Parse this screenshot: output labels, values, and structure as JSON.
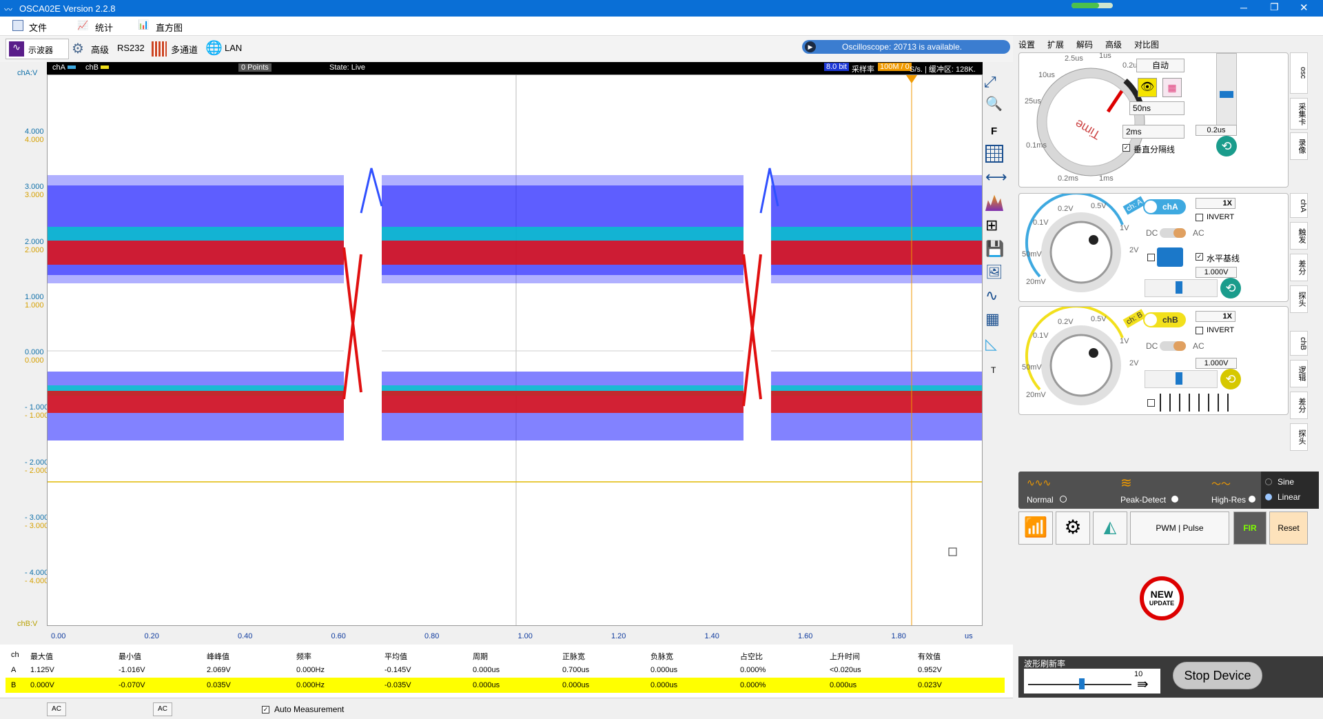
{
  "window": {
    "title": "OSCA02E  Version 2.2.8"
  },
  "menu": {
    "file": "文件",
    "stats": "统计",
    "histogram": "直方图"
  },
  "toolbar": {
    "osc": "示波器",
    "advanced": "高级",
    "rs232": "RS232",
    "multichannel": "多通道",
    "lan": "LAN"
  },
  "notice": "Oscilloscope: 20713 is available.",
  "scope": {
    "cha_label": "chA",
    "chb_label": "chB",
    "points": "0 Points",
    "state": "State: Live",
    "bits": "8.0 bit",
    "sample_rate_label": "采样率",
    "sample_rate": "100M / 0",
    "sample_rate_unit": "S/s. | 缓冲区: 128K.",
    "y_label_a": "chA:V",
    "y_label_b": "chB:V",
    "x_unit": "us"
  },
  "y_ticks_a": [
    "4.000",
    "3.000",
    "2.000",
    "1.000",
    "0.000",
    "- 1.000",
    "- 2.000",
    "- 3.000",
    "- 4.000"
  ],
  "y_ticks_b": [
    "4.000",
    "3.000",
    "2.000",
    "1.000",
    "0.000",
    "- 1.000",
    "- 2.000",
    "- 3.000",
    "- 4.000"
  ],
  "x_ticks": [
    "0.00",
    "0.20",
    "0.40",
    "0.60",
    "0.80",
    "1.00",
    "1.20",
    "1.40",
    "1.60",
    "1.80"
  ],
  "measure": {
    "headers": [
      "ch",
      "最大值",
      "最小值",
      "峰峰值",
      "频率",
      "平均值",
      "周期",
      "正脉宽",
      "负脉宽",
      "占空比",
      "上升时间",
      "有效值"
    ],
    "row_a": [
      "A",
      "1.125V",
      "-1.016V",
      "2.069V",
      "0.000Hz",
      "-0.145V",
      "0.000us",
      "0.700us",
      "0.000us",
      "0.000%",
      "<0.020us",
      "0.952V"
    ],
    "row_b": [
      "B",
      "0.000V",
      "-0.070V",
      "0.035V",
      "0.000Hz",
      "-0.035V",
      "0.000us",
      "0.000us",
      "0.000us",
      "0.000%",
      "0.000us",
      "0.023V"
    ]
  },
  "bottom": {
    "ac1": "AC",
    "ac2": "AC",
    "auto_measure": "Auto Measurement"
  },
  "tabs": [
    "设置",
    "扩展",
    "解码",
    "高级",
    "对比图"
  ],
  "right_side_tabs": {
    "osc": "osc",
    "capture": "采集卡",
    "record": "录像",
    "cha": "chA",
    "trigger": "触发",
    "diff": "差分",
    "probe": "探头",
    "chb": "chB",
    "logic": "逻辑",
    "diff2": "差分",
    "probe2": "探头"
  },
  "time": {
    "auto": "自动",
    "knob_text": "Time",
    "div_select": "50ns",
    "span_select": "2ms",
    "value": "0.2us",
    "grid_label": "垂直分隔线",
    "ticks": [
      "2.5us",
      "1us",
      "0.2us",
      "10us",
      "25us",
      "0.1ms",
      "0.2ms",
      "1ms"
    ]
  },
  "cha": {
    "label": "chA",
    "scale": "1X",
    "invert": "INVERT",
    "dc": "DC",
    "ac": "AC",
    "baseline": "水平基线",
    "value": "1.000V",
    "badge": "ch: A",
    "ticks": [
      "0.2V",
      "0.5V",
      "1V",
      "2V",
      "0.1V",
      "50mV",
      "20mV"
    ]
  },
  "chb": {
    "label": "chB",
    "scale": "1X",
    "invert": "INVERT",
    "dc": "DC",
    "ac": "AC",
    "value": "1.000V",
    "badge": "ch: B",
    "ticks": [
      "0.2V",
      "0.5V",
      "1V",
      "2V",
      "0.1V",
      "50mV",
      "20mV"
    ]
  },
  "acq": {
    "normal": "Normal",
    "peak": "Peak-Detect",
    "hires": "High-Res",
    "sine": "Sine",
    "linear": "Linear"
  },
  "tools": {
    "pwm": "PWM | Pulse",
    "fir": "FIR",
    "reset": "Reset"
  },
  "update": {
    "line1": "NEW",
    "line2": "UPDATE"
  },
  "refresh": {
    "label": "波形刷新率",
    "value": "10"
  },
  "stop": "Stop Device",
  "colors": {
    "accent": "#0a6fd6",
    "cha": "#3ea9e0",
    "chb": "#f2e01c",
    "trigger": "#f09a00"
  }
}
